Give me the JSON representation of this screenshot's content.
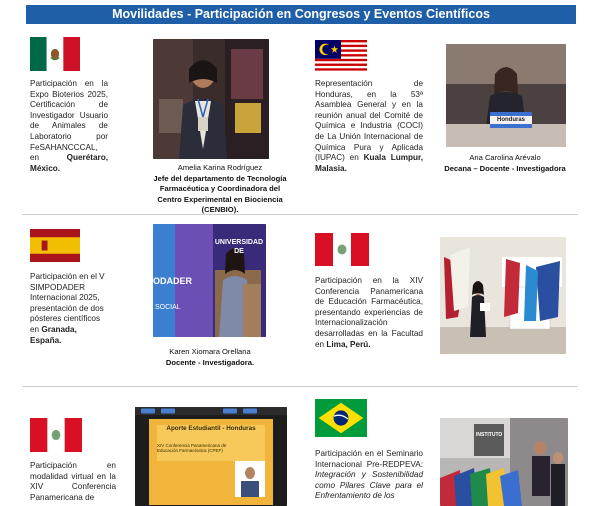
{
  "banner": {
    "title": "Movilidades - Participación en Congresos y Eventos Científicos"
  },
  "rows": [
    {
      "left": {
        "flag": "mexico-flag",
        "desc_pre": "Participación en la Expo Bioterios 2025, Certificación de Investigador Usuario de Animales de Laboratorio por FeSAHANCCCAL, en ",
        "desc_place": "Querétaro, México.",
        "name": "Amelia Karina Rodríguez",
        "role": "Jefe del departamento de Tecnología Farmacéutica y Coordinadora del Centro Experimental en Biociencia (CENBIO)."
      },
      "right": {
        "flag": "malaysia-flag",
        "desc_pre": "Representación de Honduras, en la 53ª Asamblea General y en la reunión anual del Comité de Química e Industria (COCI) de La Unión Internacional de Química Pura y Aplicada (IUPAC) en ",
        "desc_place": "Kuala Lumpur, Malasia.",
        "name": "Ana Carolina Arévalo",
        "role": "Decana – Docente - Investigadora",
        "sign": "Honduras"
      }
    },
    {
      "left": {
        "flag": "spain-flag",
        "desc_pre": "Participación en el V SIMPODADER Internacional 2025, presentación de dos pósteres científicos en ",
        "desc_place": "Granada, España.",
        "name": "Karen Xiomara Orellana",
        "role": "Docente - Investigadora.",
        "poster_lines": [
          "UNIVERSIDAD",
          "DE"
        ],
        "poster_side": "ODADER",
        "poster_social": "SOCIAL"
      },
      "right": {
        "flag": "peru-flag",
        "desc_pre": "Participación en la XIV Conferencia Panamericana de Educación Farmacéutica, presentando experiencias de Internacionalización desarrolladas en la Facultad en ",
        "desc_place": "Lima, Perú."
      }
    },
    {
      "left": {
        "flag": "peru-flag",
        "desc_pre": "Participación en modalidad virtual en la XIV Conferencia Panamericana de",
        "slide_title": "Aporte Estudiantil - Honduras",
        "slide_sub": "XIV Conferencia Panamericana de Educación Farmacéutica (CPEF)"
      },
      "right": {
        "flag": "brazil-flag",
        "desc_pre": "Participación en el Seminario Internacional Pre-REDPEVA: ",
        "desc_italic": "Integración y Sostenibilidad como Pilares Clave para el Enfrentamiento de los",
        "sign": "INSTITUTO"
      }
    }
  ],
  "colors": {
    "banner": "#1f5fa8",
    "divider": "#cfcfcf"
  }
}
